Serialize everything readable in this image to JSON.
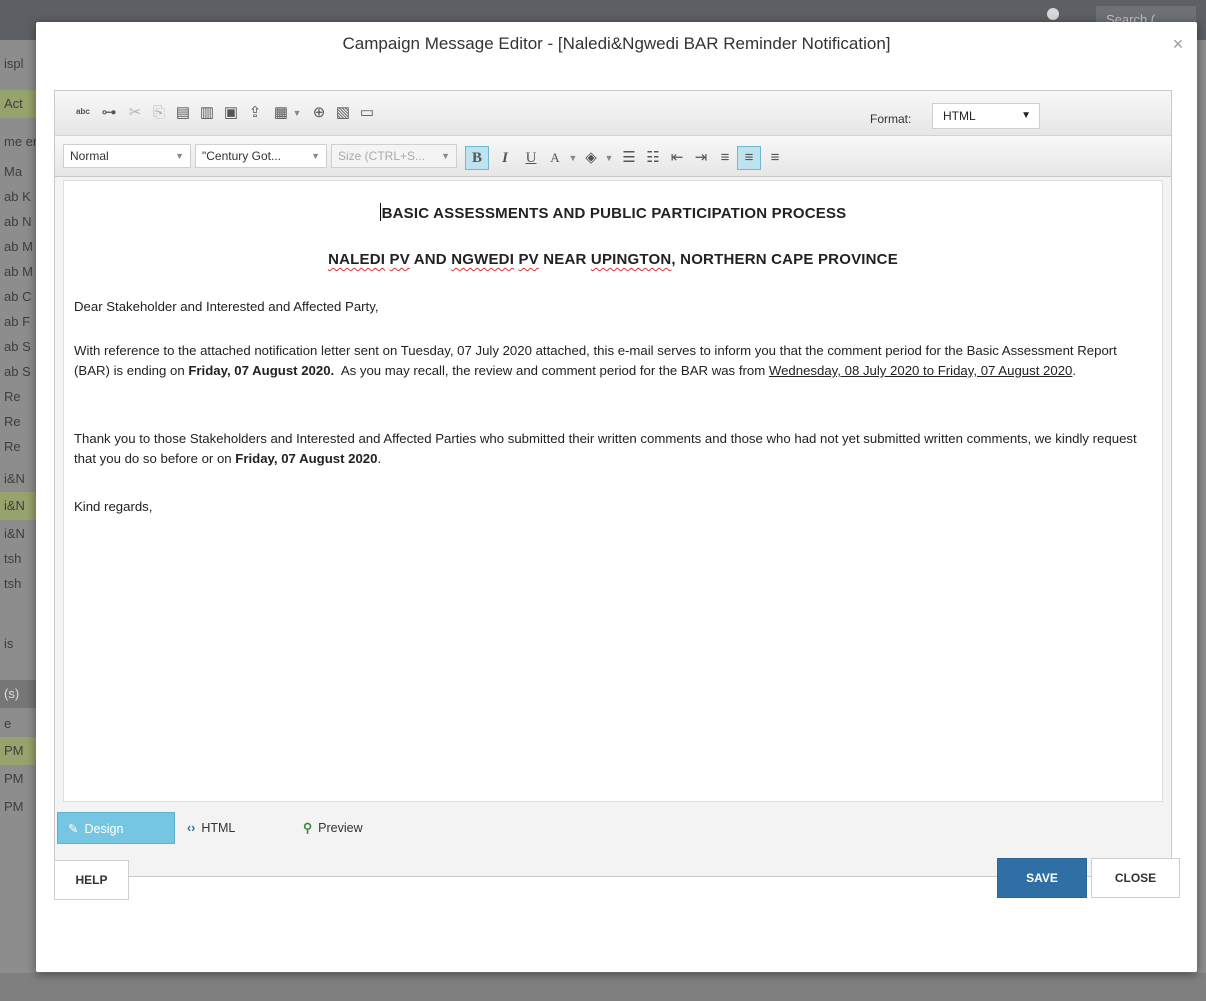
{
  "background": {
    "search_text": "Search (",
    "left_rows": [
      "ispl",
      "Act",
      "me\nerg",
      "Ma",
      "ab K",
      "ab N",
      "ab M",
      "ab M",
      "ab C",
      "ab F",
      "ab S",
      "ab S",
      "Re",
      "Re",
      "Re",
      "i&N",
      "i&N",
      "i&N",
      "tsh",
      "tsh",
      "is",
      "(s)",
      "e",
      "PM",
      "PM",
      "PM"
    ]
  },
  "modal": {
    "title": "Campaign Message Editor - [Naledi&Ngwedi BAR Reminder Notification]",
    "close_glyph": "×"
  },
  "toolbar": {
    "format_label": "Format:",
    "format_value": "HTML",
    "style_value": "Normal",
    "font_value": "\"Century Got...",
    "size_placeholder": "Size (CTRL+S..."
  },
  "document": {
    "heading1": "BASIC ASSESSMENTS AND PUBLIC PARTICIPATION PROCESS",
    "heading2": {
      "p1": "NALEDI",
      "p2": "PV",
      "p3": " AND ",
      "p4": "NGWEDI",
      "p5": "PV",
      "p6": " NEAR ",
      "p7": "UPINGTON",
      "p8": ", NORTHERN CAPE PROVINCE"
    },
    "greeting": "Dear Stakeholder and Interested and Affected Party,",
    "para1": {
      "t1": "With reference to the attached notification letter sent on Tuesday, 07 July 2020 attached, this e-mail serves to inform you that the comment period for the Basic Assessment Report (BAR) is ending on ",
      "b1": "Friday, 07 August 2020.",
      "t2": "  As you may recall, the review and comment period for the BAR was from ",
      "u1": "Wednesday, 08 July 2020 to Friday, 07 August 2020",
      "t3": "."
    },
    "para2": {
      "t1": "Thank you to those Stakeholders and Interested and Affected Parties who submitted their written comments and those who had not yet submitted written comments, we kindly request that you do so before or on ",
      "b1": "Friday, 07 August 2020",
      "t2": "."
    },
    "closing": "Kind regards,"
  },
  "mode_tabs": {
    "design": "Design",
    "html": "HTML",
    "preview": "Preview"
  },
  "buttons": {
    "help": "HELP",
    "save": "SAVE",
    "close": "CLOSE"
  },
  "colors": {
    "save_button": "#2f6fa6",
    "active_tab": "#74c6e3"
  }
}
